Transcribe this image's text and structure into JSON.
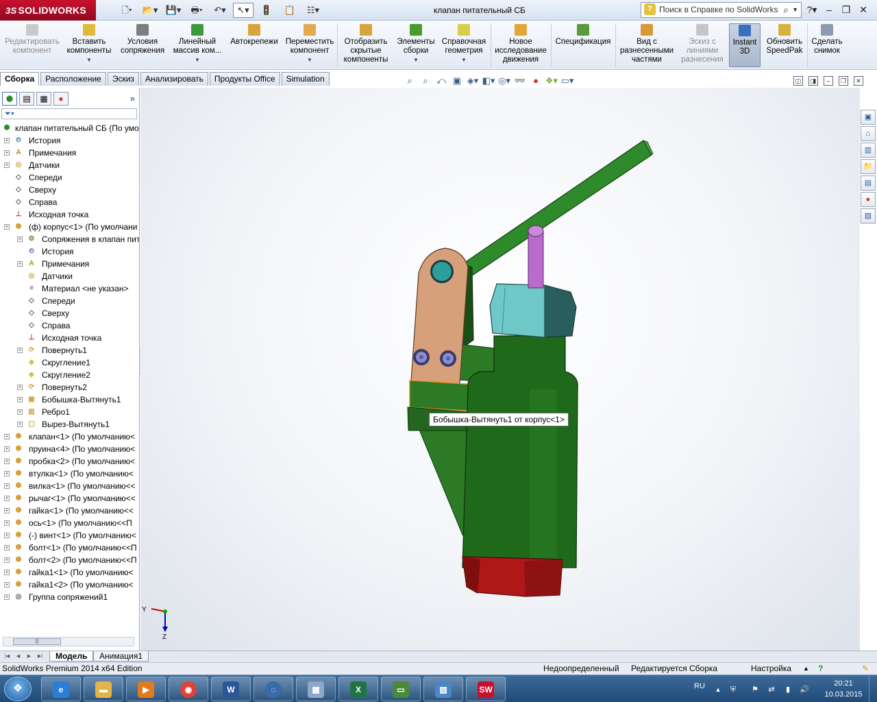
{
  "window": {
    "app_logo": "SOLIDWORKS",
    "app_logo_prefix": "3S",
    "title": "клапан питательный СБ",
    "help_search_placeholder": "Поиск в Справке по SolidWorks"
  },
  "ribbon": {
    "edit_component": "Редактировать компонент",
    "insert_components": "Вставить компоненты",
    "mate": "Условия сопряжения",
    "linear_pattern": "Линейный массив ком...",
    "smart_fasteners": "Автокрепежи",
    "move_component": "Переместить компонент",
    "show_hidden": "Отобразить скрытые компоненты",
    "assembly_features": "Элементы сборки",
    "reference_geometry": "Справочная геометрия",
    "new_motion_study": "Новое исследование движения",
    "bom": "Спецификация",
    "exploded_view": "Вид с разнесенными частями",
    "explode_line_sketch": "Эскиз с линиями разнесения",
    "instant3d": "Instant 3D",
    "speedpak": "Обновить SpeedPak",
    "snapshot": "Сделать снимок"
  },
  "tabs": [
    "Сборка",
    "Расположение",
    "Эскиз",
    "Анализировать",
    "Продукты Office",
    "Simulation"
  ],
  "tree": {
    "root": "клапан питательный СБ  (По умолч",
    "items": [
      {
        "label": "История"
      },
      {
        "label": "Примечания"
      },
      {
        "label": "Датчики"
      },
      {
        "label": "Спереди"
      },
      {
        "label": "Сверху"
      },
      {
        "label": "Справа"
      },
      {
        "label": "Исходная точка"
      },
      {
        "label": "(ф) корпус<1> (По умолчани"
      },
      {
        "label": "Сопряжения в клапан пит"
      },
      {
        "label": "История"
      },
      {
        "label": "Примечания"
      },
      {
        "label": "Датчики"
      },
      {
        "label": "Материал <не указан>"
      },
      {
        "label": "Спереди"
      },
      {
        "label": "Сверху"
      },
      {
        "label": "Справа"
      },
      {
        "label": "Исходная точка"
      },
      {
        "label": "Повернуть1"
      },
      {
        "label": "Скругление1"
      },
      {
        "label": "Скругление2"
      },
      {
        "label": "Повернуть2"
      },
      {
        "label": "Бобышка-Вытянуть1"
      },
      {
        "label": "Ребро1"
      },
      {
        "label": "Вырез-Вытянуть1"
      },
      {
        "label": "клапан<1> (По умолчанию<"
      },
      {
        "label": "пруина<4> (По умолчанию<"
      },
      {
        "label": "пробка<2> (По умолчанию<"
      },
      {
        "label": "втулка<1> (По умолчанию<"
      },
      {
        "label": "вилка<1> (По умолчанию<<"
      },
      {
        "label": "рычаг<1> (По умолчанию<<"
      },
      {
        "label": "гайка<1> (По умолчанию<<"
      },
      {
        "label": "ось<1> (По умолчанию<<П"
      },
      {
        "label": "(-) винт<1> (По умолчанию<"
      },
      {
        "label": "болт<1> (По умолчанию<<П"
      },
      {
        "label": "болт<2> (По умолчанию<<П"
      },
      {
        "label": "гайка1<1> (По умолчанию<"
      },
      {
        "label": "гайка1<2> (По умолчанию<"
      },
      {
        "label": "Группа сопряжений1"
      }
    ]
  },
  "viewport": {
    "tooltip": "Бобышка-Вытянуть1 от корпус<1>",
    "triad_y": "Y",
    "triad_z": "Z"
  },
  "bottom_tabs": [
    "Модель",
    "Анимация1"
  ],
  "status": {
    "edition": "SolidWorks Premium 2014 x64 Edition",
    "definition": "Недоопределенный",
    "editing": "Редактируется Сборка",
    "custom": "Настройка"
  },
  "taskbar": {
    "lang": "RU",
    "time": "20:21",
    "date": "10.03.2015"
  },
  "colors": {
    "body_green": "#1f6a1a",
    "lever_green": "#2e8a2a",
    "plate_tan": "#d6a07a",
    "nut_cyan": "#6fc8c8",
    "pin_purple": "#b96bc9",
    "plug_red": "#b01818"
  }
}
